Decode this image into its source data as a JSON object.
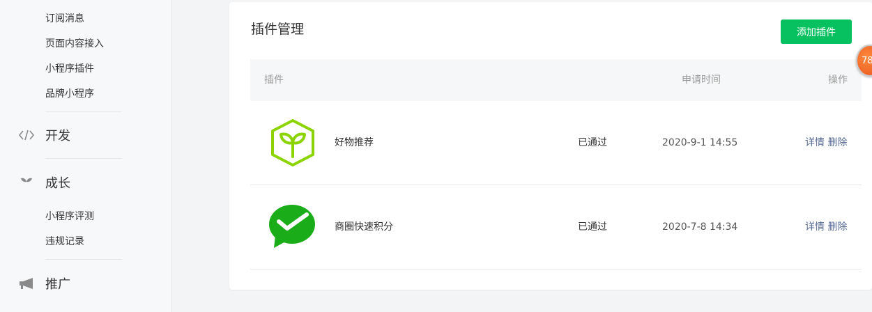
{
  "sidebar": {
    "sub_items_top": [
      "订阅消息",
      "页面内容接入",
      "小程序插件",
      "品牌小程序"
    ],
    "groups": {
      "dev": {
        "label": "开发",
        "icon": "code-icon"
      },
      "growth": {
        "label": "成长",
        "icon": "sprout-icon"
      },
      "promo": {
        "label": "推广",
        "icon": "megaphone-icon"
      }
    },
    "growth_items": [
      "小程序评测",
      "违规记录"
    ]
  },
  "main": {
    "title": "插件管理",
    "add_button": "添加插件",
    "table": {
      "headers": {
        "plugin": "插件",
        "apply_time": "申请时间",
        "actions": "操作"
      },
      "rows": [
        {
          "name": "好物推荐",
          "status": "已通过",
          "time": "2020-9-1 14:55",
          "detail": "详情",
          "delete": "删除",
          "logo": "green-sprout-hexagon-logo"
        },
        {
          "name": "商圈快速积分",
          "status": "已通过",
          "time": "2020-7-8 14:34",
          "detail": "详情",
          "delete": "删除",
          "logo": "wechat-pay-logo"
        }
      ]
    }
  },
  "floating_badge": {
    "text": "78"
  },
  "colors": {
    "primary": "#07c160",
    "link": "#576b95",
    "plugin_green": "#8bd400",
    "wechat_green": "#1aad19",
    "badge": "#f07024"
  }
}
